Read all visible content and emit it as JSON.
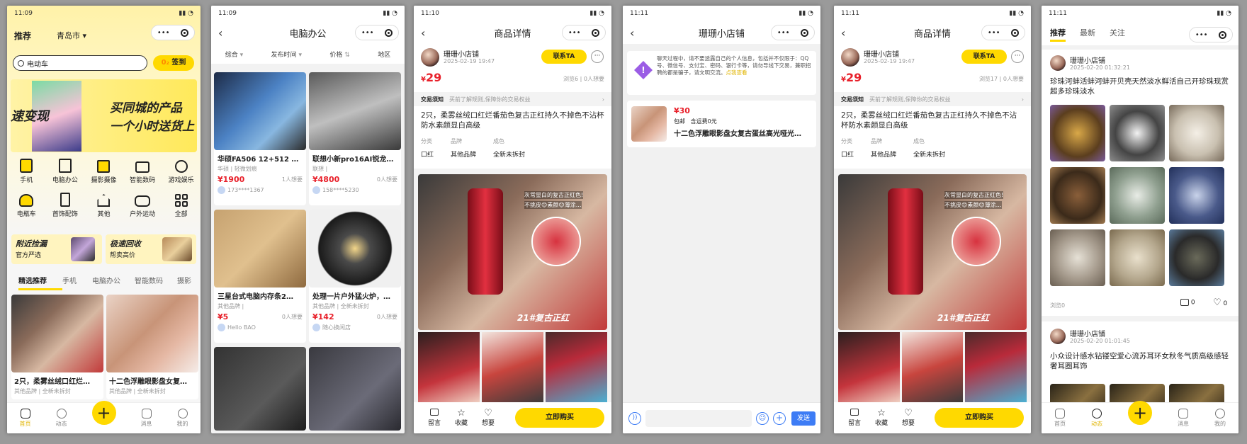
{
  "colors": {
    "accent": "#ffd900",
    "price": "#e8202a",
    "send": "#3d7cf5"
  },
  "s1": {
    "status_time": "11:09",
    "title": "推荐",
    "city": "青岛市",
    "search_value": "电动车",
    "checkin": "签到",
    "banner_left": "速变现",
    "banner_title1": "买同城的产品",
    "banner_title2": "一个小时送货上",
    "cats": [
      "手机",
      "电脑办公",
      "摄影摄像",
      "智能数码",
      "游戏娱乐",
      "电瓶车",
      "首饰配饰",
      "其他",
      "户外运动",
      "全部"
    ],
    "promo1_title": "附近捡漏",
    "promo1_sub": "官方严选",
    "promo2_title": "极速回收",
    "promo2_sub": "帮卖高价",
    "tabs": [
      "精选推荐",
      "手机",
      "电脑办公",
      "智能数码",
      "摄影"
    ],
    "item1_title": "2只，柔雾丝绒口红烂…",
    "item1_meta": "其他品牌 | 全新未拆封",
    "item2_title": "十二色浮雕眼影盘女复…",
    "item2_meta": "其他品牌 | 全新未拆封",
    "tabbar": [
      "首页",
      "动态",
      "消息",
      "我的"
    ]
  },
  "s2": {
    "status_time": "11:09",
    "title": "电脑办公",
    "filters": [
      "综合",
      "发布时间",
      "价格",
      "地区"
    ],
    "items": [
      {
        "title": "华硕FA506 12+512 …",
        "meta": "华硕 | 轻微划痕",
        "price": "¥1900",
        "want": "1人想要",
        "user": "173****1367"
      },
      {
        "title": "联想小新pro16AI锐龙…",
        "meta": "联想 |",
        "price": "¥4800",
        "want": "0人想要",
        "user": "158****5230"
      },
      {
        "title": "三星台式电脑内存条2…",
        "meta": "其他品牌 |",
        "price": "¥5",
        "want": "0人想要",
        "user": "Hello BAO"
      },
      {
        "title": "处理一片户外猛火炉，…",
        "meta": "其他品牌 | 全新未拆封",
        "price": "¥142",
        "want": "0人想要",
        "user": "随心换闲店"
      }
    ]
  },
  "detail_a": {
    "status_time": "11:10",
    "title": "商品详情",
    "shop": "珊珊小店铺",
    "date": "2025-02-19 19:47",
    "contact": "联系TA",
    "price_symbol": "¥",
    "price": "29",
    "views": "浏览6 | 0人想要",
    "notice_label": "交易须知",
    "notice_text": "买前了解规则,保障你的交易权益",
    "desc": "2只，柔雾丝绒口红烂番茄色复古正红持久不掉色不沾杯防水素颜显白高级",
    "attr_keys": [
      "分类",
      "品牌",
      "成色"
    ],
    "attr_vals": [
      "口红",
      "其他品牌",
      "全新未拆封"
    ],
    "img_text1": "灰常显白的复古正红色!",
    "img_text2": "不挑皮😊素颜😊薄涂…",
    "img_text3": "21#复古正红",
    "actions": [
      "留言",
      "收藏",
      "想要"
    ],
    "buy": "立即购买"
  },
  "s4": {
    "status_time": "11:11",
    "title": "珊珊小店铺",
    "warning": "聊天过程中，请不要透露自己的个人信息，包括并不仅限于：QQ号、微信号、支付宝、密码、银行卡等，请勿导线下交易，兼职招聘的都是骗子，请文明交流。",
    "warning_link": "点我查看",
    "price": "¥30",
    "shipping": "包邮",
    "shipping_fee": "含运费0元",
    "item_title": "十二色浮雕眼影盘女复古蛋丝高光哑光…",
    "send": "发送"
  },
  "detail_b": {
    "status_time": "11:11",
    "views": "浏览17 | 0人想要"
  },
  "s6": {
    "status_time": "11:11",
    "tabs": [
      "推荐",
      "最新",
      "关注"
    ],
    "post1_user": "珊珊小店铺",
    "post1_date": "2025-02-20 01:32:21",
    "post1_text": "珍珠河蚌活蚌河蚌开贝壳天然淡水鲜活自己开珍珠现赏超多珍珠淡水",
    "post1_views": "浏览0",
    "post1_comments": "0",
    "post1_likes": "0",
    "post2_user": "珊珊小店铺",
    "post2_date": "2025-02-20 01:01:45",
    "post2_text": "小众设计感水钻镂空爱心流苏耳环女秋冬气质高级感轻奢耳圈耳饰",
    "tabbar": [
      "首页",
      "动态",
      "消息",
      "我的"
    ]
  }
}
